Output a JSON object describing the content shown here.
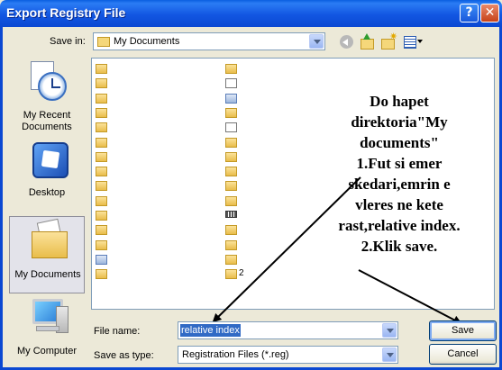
{
  "window": {
    "title": "Export Registry File",
    "help_glyph": "?",
    "close_glyph": "✕"
  },
  "toolbar": {
    "save_in_label": "Save in:",
    "save_in_value": "My Documents"
  },
  "places": [
    {
      "label": "My Recent Documents",
      "icon": "recent-documents-icon"
    },
    {
      "label": "Desktop",
      "icon": "desktop-icon"
    },
    {
      "label": "My Documents",
      "icon": "my-documents-icon",
      "selected": true
    },
    {
      "label": "My Computer",
      "icon": "my-computer-icon"
    }
  ],
  "file_list": {
    "left_column_fragments": [
      "",
      "",
      "",
      "",
      "",
      "",
      "",
      "",
      "",
      "",
      "",
      "",
      "",
      "",
      ""
    ],
    "right_column_fragments": [
      "",
      "",
      "",
      "",
      "",
      "",
      "",
      "",
      "",
      "",
      "",
      "",
      "",
      "",
      "2"
    ]
  },
  "annotation": {
    "lines": [
      "Do hapet",
      "direktoria\"My",
      "documents\"",
      "1.Fut si emer",
      "skedari,emrin e",
      "vleres ne kete",
      "rast,relative index.",
      "2.Klik save."
    ]
  },
  "form": {
    "file_name_label": "File name:",
    "file_name_value": "relative index",
    "save_as_type_label": "Save as type:",
    "save_as_type_value": "Registration Files (*.reg)"
  },
  "buttons": {
    "save": "Save",
    "cancel": "Cancel"
  }
}
